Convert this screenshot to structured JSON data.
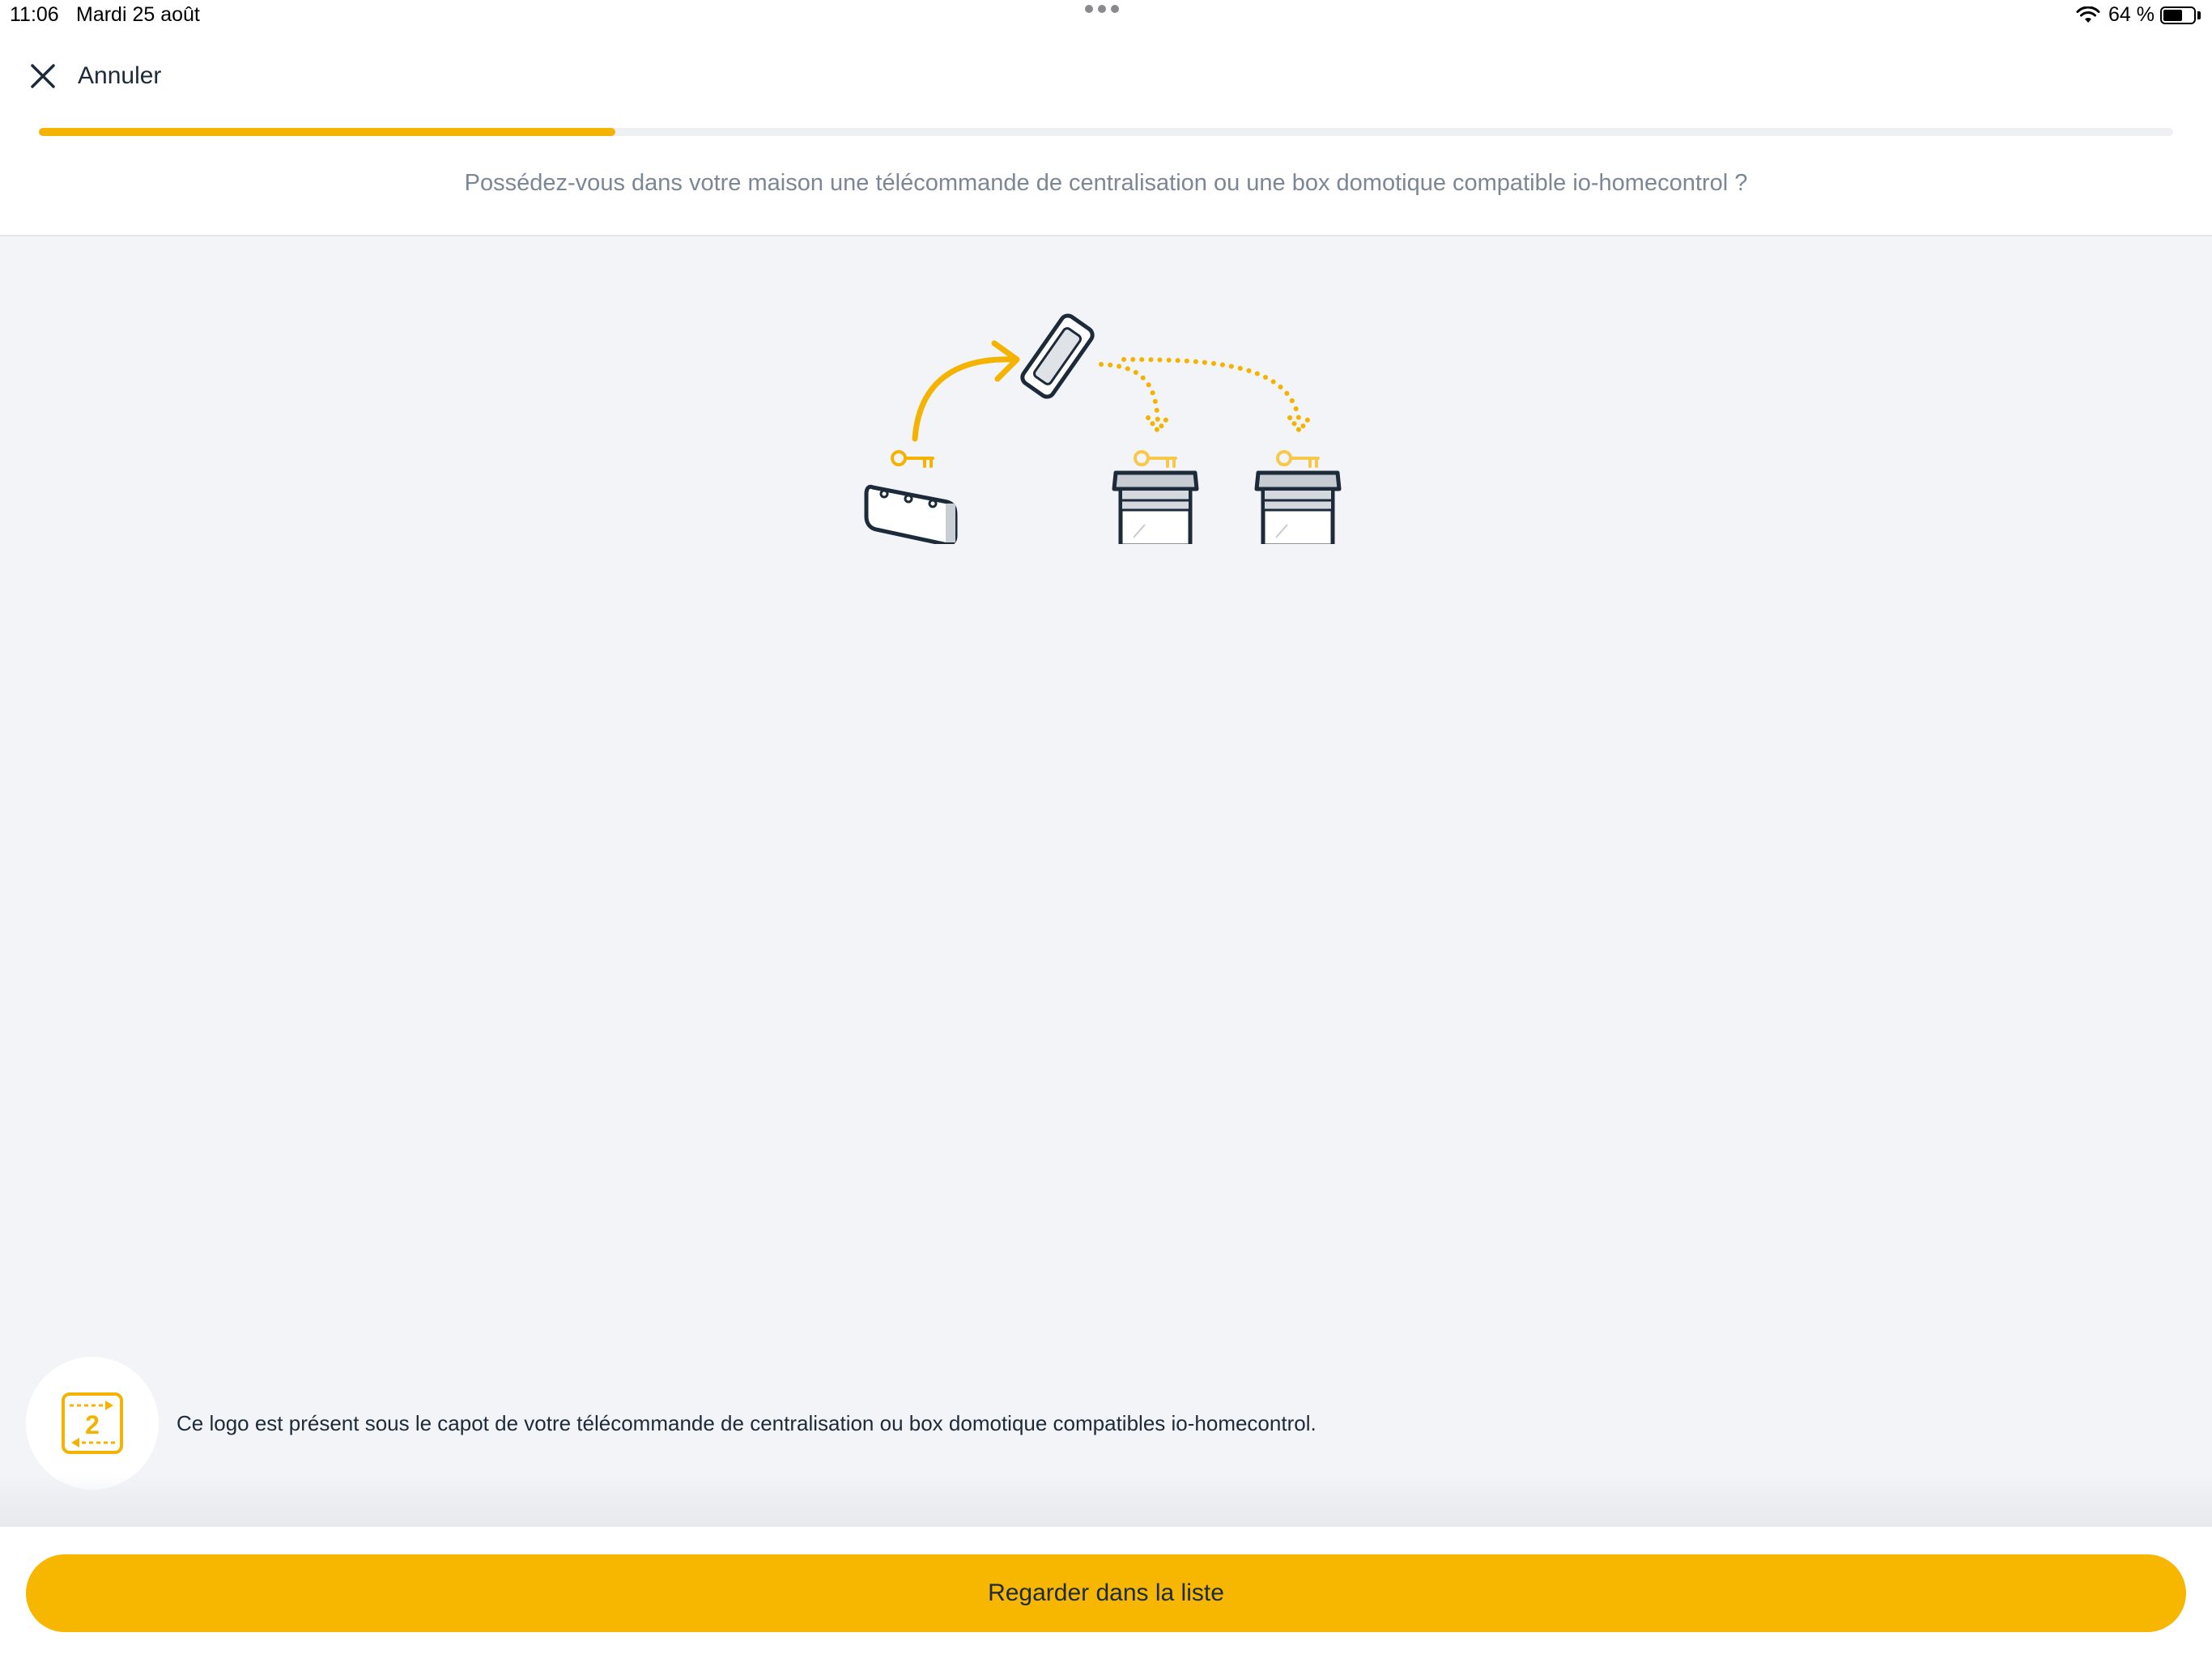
{
  "status_bar": {
    "time": "11:06",
    "date": "Mardi 25 août",
    "battery_text": "64 %",
    "battery_level": 0.64,
    "icons": [
      "multitasking-dots-icon",
      "wifi-icon",
      "battery-icon"
    ]
  },
  "header": {
    "cancel_label": "Annuler",
    "cancel_icon": "close-icon",
    "progress": 0.27,
    "question": "Possédez-vous dans votre maison une télécommande de centralisation ou une box domotique compatible io-homecontrol ?"
  },
  "illustration": {
    "icons": [
      "box-device-icon",
      "remote-control-icon",
      "key-icon",
      "shutter-icon"
    ]
  },
  "info": {
    "logo_icon": "io-homecontrol-logo-icon",
    "logo_digit": "2",
    "text": "Ce logo est présent sous le capot de votre télécommande de centralisation ou box domotique compatibles io-homecontrol."
  },
  "footer": {
    "cta_label": "Regarder dans la liste"
  },
  "colors": {
    "accent": "#f7b600",
    "text_primary": "#1d2a3a",
    "text_secondary": "#7b8696",
    "background": "#f2f4f7"
  }
}
